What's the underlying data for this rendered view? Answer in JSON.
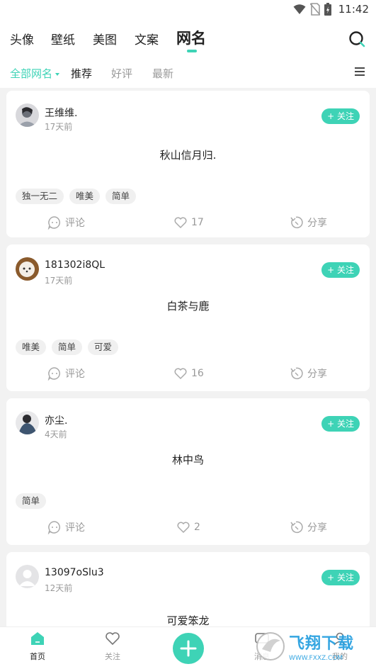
{
  "status": {
    "time": "11:42"
  },
  "top_nav": {
    "items": [
      "头像",
      "壁纸",
      "美图",
      "文案",
      "网名"
    ],
    "active_index": 4
  },
  "sub_nav": {
    "dropdown_label": "全部网名",
    "items": [
      "推荐",
      "好评",
      "最新"
    ]
  },
  "posts": [
    {
      "user": "王维维.",
      "time": "17天前",
      "follow_label": "+ 关注",
      "content": "秋山信月归.",
      "tags": [
        "独一无二",
        "唯美",
        "简单"
      ],
      "comment_label": "评论",
      "likes": "17",
      "share_label": "分享"
    },
    {
      "user": "181302i8QL",
      "time": "17天前",
      "follow_label": "+ 关注",
      "content": "白茶与鹿",
      "tags": [
        "唯美",
        "简单",
        "可爱"
      ],
      "comment_label": "评论",
      "likes": "16",
      "share_label": "分享"
    },
    {
      "user": "亦尘.",
      "time": "4天前",
      "follow_label": "+ 关注",
      "content": "林中鸟",
      "tags": [
        "简单"
      ],
      "comment_label": "评论",
      "likes": "2",
      "share_label": "分享"
    },
    {
      "user": "13097oSlu3",
      "time": "12天前",
      "follow_label": "+ 关注",
      "content": "可爱笨龙"
    }
  ],
  "bottom_tabs": [
    {
      "label": "首页"
    },
    {
      "label": "关注"
    },
    {
      "label": "消息"
    },
    {
      "label": "我的"
    }
  ],
  "watermark": {
    "title": "飞翔下载",
    "url": "WWW.FXXZ.COM"
  },
  "colors": {
    "accent": "#3ed3b6"
  }
}
